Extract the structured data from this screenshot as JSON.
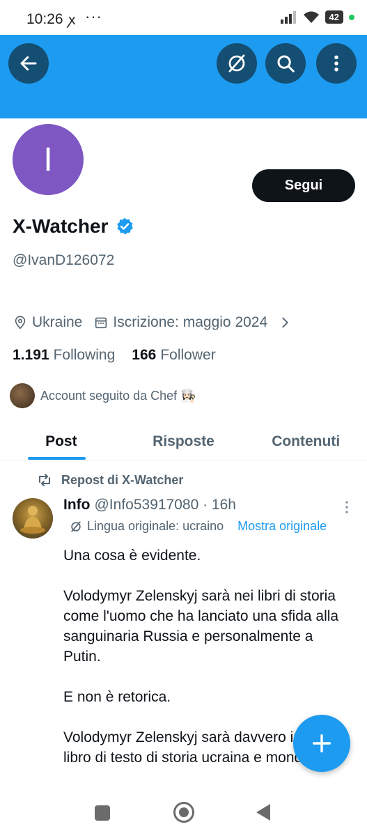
{
  "status_bar": {
    "time": "10:26",
    "app_icon": "ꭗ",
    "dots": "···",
    "battery": "42"
  },
  "header": {
    "back_icon": "arrow-left-icon",
    "grok_icon": "grok-icon",
    "search_icon": "search-icon",
    "more_icon": "more-vertical-icon"
  },
  "profile": {
    "avatar_letter": "I",
    "follow_label": "Segui",
    "display_name": "X-Watcher",
    "handle": "@IvanD126072",
    "location": "Ukraine",
    "joined": "Iscrizione: maggio 2024",
    "following_count": "1.191",
    "following_label": "Following",
    "followers_count": "166",
    "followers_label": "Follower",
    "followed_by": "Account seguito da Chef 👩🏻‍🍳"
  },
  "tabs": [
    {
      "label": "Post",
      "active": true
    },
    {
      "label": "Risposte",
      "active": false
    },
    {
      "label": "Contenuti",
      "active": false
    }
  ],
  "tweet": {
    "repost_label": "Repost di X-Watcher",
    "author_name": "Info",
    "author_handle": "@Info53917080 · 16h",
    "translation_note": "Lingua originale: ucraino",
    "show_original": "Mostra originale",
    "paragraphs": [
      "Una cosa è evidente.",
      "Volodymyr Zelenskyj sarà nei libri di storia come l'uomo che ha lanciato una sfida alla sanguinaria Russia e personalmente a Putin.",
      "E non è retorica.",
      "Volodymyr Zelenskyj sarà davvero in ogni libro di testo di storia ucraina e mondiale."
    ]
  },
  "colors": {
    "accent": "#1d9bf0",
    "header_button": "#144e73",
    "avatar": "#7e57c2",
    "text": "#0f1419",
    "muted": "#536471"
  }
}
